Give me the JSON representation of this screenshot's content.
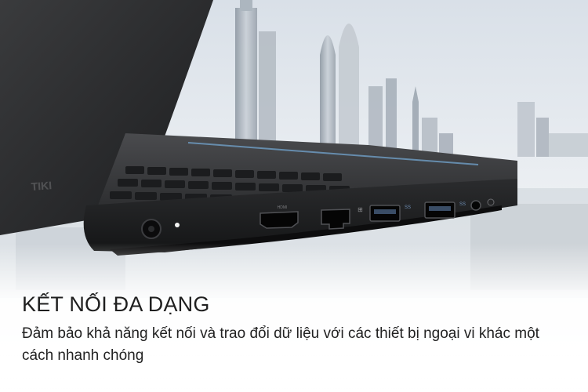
{
  "feature": {
    "heading": "KẾT NỐI ĐA DẠNG",
    "description": "Đảm bảo khả năng kết nối và trao đổi dữ liệu với các thiết bị ngoại vi khác một cách nhanh chóng"
  },
  "watermark": "TIKI",
  "port_labels": {
    "hdmi": "HDMI",
    "usb_a": "SS",
    "usb_b": "SS"
  }
}
